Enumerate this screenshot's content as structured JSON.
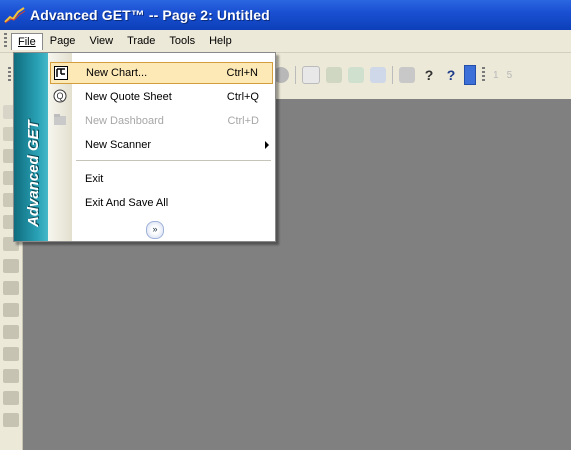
{
  "window": {
    "title": "Advanced GET™ -- Page 2: Untitled",
    "icon": "chart-trend-icon"
  },
  "menubar": {
    "items": [
      {
        "label": "File",
        "underline": "F"
      },
      {
        "label": "Page",
        "underline": "P"
      },
      {
        "label": "View",
        "underline": "V"
      },
      {
        "label": "Trade",
        "underline": "r"
      },
      {
        "label": "Tools",
        "underline": "T"
      },
      {
        "label": "Help",
        "underline": "H"
      }
    ],
    "active": "File"
  },
  "file_menu": {
    "banner": "Advanced GET",
    "items": [
      {
        "label": "New Chart...",
        "shortcut": "Ctrl+N",
        "icon": "new-chart-icon",
        "highlighted": true,
        "enabled": true
      },
      {
        "label": "New Quote Sheet",
        "shortcut": "Ctrl+Q",
        "icon": "quote-sheet-icon",
        "enabled": true
      },
      {
        "label": "New Dashboard",
        "shortcut": "Ctrl+D",
        "icon": "dashboard-icon",
        "enabled": false
      },
      {
        "label": "New Scanner",
        "shortcut": "",
        "icon": "",
        "submenu": true,
        "enabled": true
      },
      {
        "label": "Exit",
        "shortcut": "",
        "enabled": true
      },
      {
        "label": "Exit And Save All",
        "shortcut": "",
        "enabled": true
      }
    ],
    "expand_icon": "double-chevron-down-icon"
  },
  "toolbar": {
    "tail_text": [
      "1",
      "5"
    ]
  },
  "colors": {
    "titlebar": "#1a50d3",
    "menubar": "#ece9d8",
    "mdi_background": "#808080",
    "banner": "#1f8fa2",
    "highlight": "#fde9b6"
  }
}
